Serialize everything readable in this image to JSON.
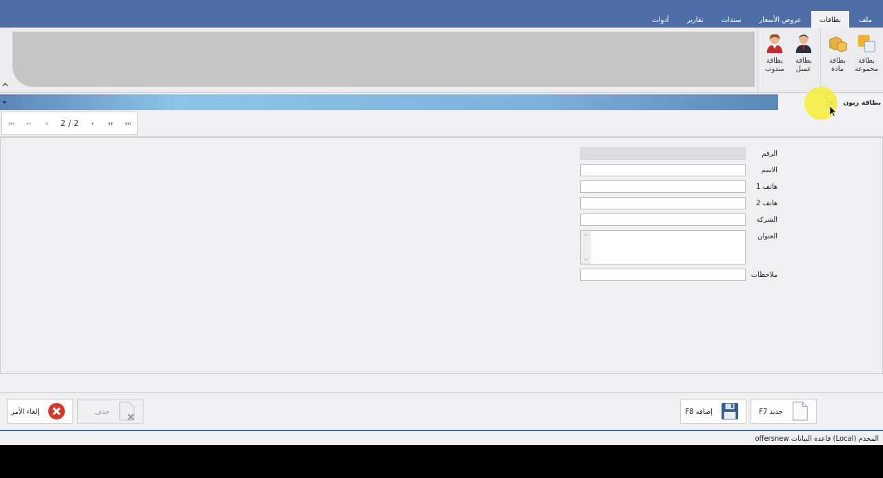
{
  "menu_tabs": [
    {
      "label": "ملف",
      "selected": false
    },
    {
      "label": "بطاقات",
      "selected": true
    },
    {
      "label": "عروض الأسعار",
      "selected": false
    },
    {
      "label": "سندات",
      "selected": false
    },
    {
      "label": "تقارير",
      "selected": false
    },
    {
      "label": "أدوات",
      "selected": false
    }
  ],
  "ribbon_groups": [
    {
      "items": [
        {
          "label": "بطاقة مجموعة",
          "kind": "group"
        },
        {
          "label": "بطاقة مادة",
          "kind": "material"
        }
      ]
    },
    {
      "items": [
        {
          "label": "بطاقة عميل",
          "kind": "client"
        },
        {
          "label": "بطاقة مندوب",
          "kind": "agent"
        }
      ]
    }
  ],
  "document_tab": {
    "title": "بطاقة زبون"
  },
  "navigator": {
    "position": "2 / 2"
  },
  "fields": [
    {
      "label": "الرقم",
      "kind": "text",
      "disabled": true
    },
    {
      "label": "الاسم",
      "kind": "text",
      "disabled": false
    },
    {
      "label": "هاتف 1",
      "kind": "text",
      "disabled": false
    },
    {
      "label": "هاتف 2",
      "kind": "text",
      "disabled": false
    },
    {
      "label": "الشركة",
      "kind": "text",
      "disabled": false
    },
    {
      "label": "العنوان",
      "kind": "textarea",
      "disabled": false
    },
    {
      "label": "ملاحظات",
      "kind": "text",
      "disabled": false
    }
  ],
  "actions_right": [
    {
      "label": "جديد F7",
      "kind": "new",
      "disabled": false
    },
    {
      "label": "إضافة F8",
      "kind": "save",
      "disabled": false
    }
  ],
  "actions_left": [
    {
      "label": "حذف",
      "kind": "delete",
      "disabled": true
    },
    {
      "label": "إلغاء الأمر",
      "kind": "cancel",
      "disabled": false
    }
  ],
  "status_bar": {
    "text": "المخدم (Local) قاعدة البيانات offersnew"
  }
}
